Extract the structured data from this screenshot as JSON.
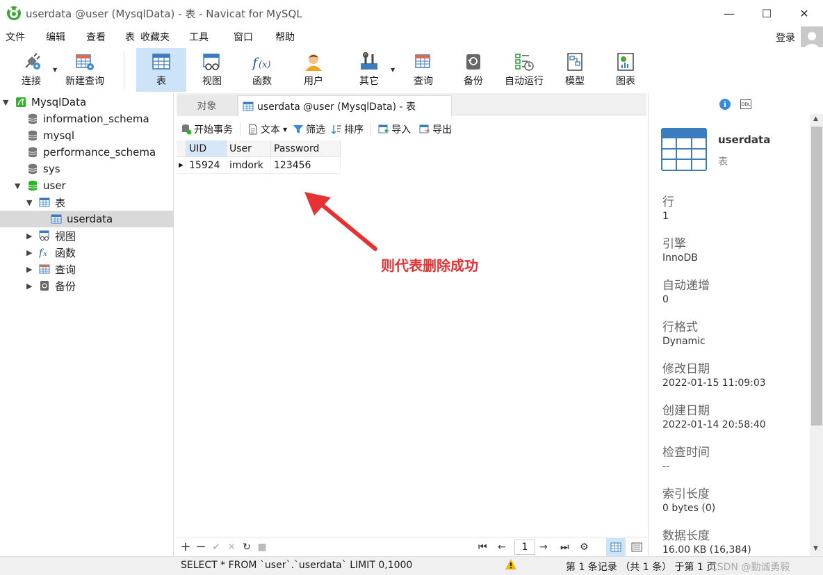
{
  "window": {
    "title": "userdata @user (MysqlData) - 表 - Navicat for MySQL",
    "controls": {
      "minimize": "—",
      "maximize": "☐",
      "close": "✕"
    }
  },
  "menu": [
    "文件",
    "编辑",
    "查看",
    "表",
    "收藏夹",
    "工具",
    "窗口",
    "帮助"
  ],
  "account": {
    "login": "登录"
  },
  "toolbar": [
    {
      "label": "连接",
      "icon": "connection-plug-icon"
    },
    {
      "label": "新建查询",
      "icon": "new-query-icon"
    },
    {
      "label": "表",
      "icon": "table-icon",
      "active": true
    },
    {
      "label": "视图",
      "icon": "view-icon"
    },
    {
      "label": "函数",
      "icon": "function-icon"
    },
    {
      "label": "用户",
      "icon": "user-icon"
    },
    {
      "label": "其它",
      "icon": "tools-icon"
    },
    {
      "label": "查询",
      "icon": "query-icon"
    },
    {
      "label": "备份",
      "icon": "backup-icon"
    },
    {
      "label": "自动运行",
      "icon": "schedule-icon"
    },
    {
      "label": "模型",
      "icon": "model-icon"
    },
    {
      "label": "图表",
      "icon": "chart-icon"
    }
  ],
  "tree": {
    "connection": "MysqlData",
    "databases": [
      "information_schema",
      "mysql",
      "performance_schema",
      "sys",
      "user"
    ],
    "user_children": {
      "tables_label": "表",
      "table": "userdata",
      "views": "视图",
      "functions": "函数",
      "queries": "查询",
      "backups": "备份"
    }
  },
  "tabs": {
    "objects": "对象",
    "current": "userdata @user (MysqlData) - 表"
  },
  "subtoolbar": {
    "begin_transaction": "开始事务",
    "text": "文本",
    "filter": "筛选",
    "sort": "排序",
    "import": "导入",
    "export": "导出"
  },
  "grid": {
    "columns": [
      "UID",
      "User",
      "Password"
    ],
    "rows": [
      [
        "15924",
        "imdork",
        "123456"
      ]
    ]
  },
  "annotation": "则代表删除成功",
  "bottom": {
    "page": "1"
  },
  "info": {
    "name": "userdata",
    "type": "表",
    "fields": [
      {
        "label": "行",
        "value": "1"
      },
      {
        "label": "引擎",
        "value": "InnoDB"
      },
      {
        "label": "自动递增",
        "value": "0"
      },
      {
        "label": "行格式",
        "value": "Dynamic"
      },
      {
        "label": "修改日期",
        "value": "2022-01-15 11:09:03"
      },
      {
        "label": "创建日期",
        "value": "2022-01-14 20:58:40"
      },
      {
        "label": "检查时间",
        "value": "--"
      },
      {
        "label": "索引长度",
        "value": "0 bytes (0)"
      },
      {
        "label": "数据长度",
        "value": "16.00 KB (16,384)"
      }
    ]
  },
  "status": {
    "sql": "SELECT * FROM `user`.`userdata` LIMIT 0,1000",
    "records": "第 1 条记录 （共 1 条） 于第 1 页",
    "watermark": "CSDN @勤诚勇毅"
  },
  "colors": {
    "accent": "#cde3f7",
    "annotation": "#e53333",
    "db_green": "#2db52d",
    "table_blue": "#3b7cc0"
  }
}
